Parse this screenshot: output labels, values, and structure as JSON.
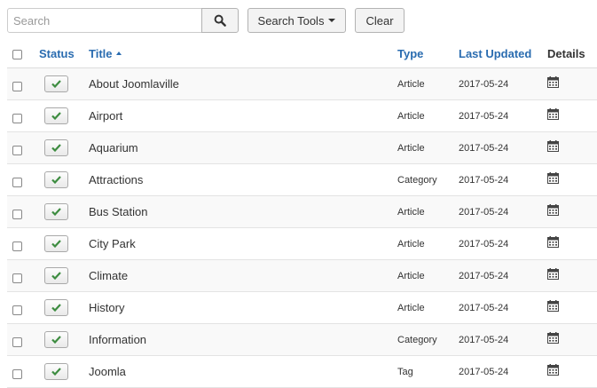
{
  "toolbar": {
    "search_placeholder": "Search",
    "search_tools_label": "Search Tools",
    "clear_label": "Clear"
  },
  "table": {
    "headers": {
      "status": "Status",
      "title": "Title",
      "type": "Type",
      "last_updated": "Last Updated",
      "details": "Details"
    },
    "sort": {
      "column": "Title",
      "direction": "ascending"
    },
    "rows": [
      {
        "status": "published",
        "title": "About Joomlaville",
        "type": "Article",
        "date": "2017-05-24"
      },
      {
        "status": "published",
        "title": "Airport",
        "type": "Article",
        "date": "2017-05-24"
      },
      {
        "status": "published",
        "title": "Aquarium",
        "type": "Article",
        "date": "2017-05-24"
      },
      {
        "status": "published",
        "title": "Attractions",
        "type": "Category",
        "date": "2017-05-24"
      },
      {
        "status": "published",
        "title": "Bus Station",
        "type": "Article",
        "date": "2017-05-24"
      },
      {
        "status": "published",
        "title": "City Park",
        "type": "Article",
        "date": "2017-05-24"
      },
      {
        "status": "published",
        "title": "Climate",
        "type": "Article",
        "date": "2017-05-24"
      },
      {
        "status": "published",
        "title": "History",
        "type": "Article",
        "date": "2017-05-24"
      },
      {
        "status": "published",
        "title": "Information",
        "type": "Category",
        "date": "2017-05-24"
      },
      {
        "status": "published",
        "title": "Joomla",
        "type": "Tag",
        "date": "2017-05-24"
      }
    ]
  },
  "colors": {
    "link": "#2a6cb0",
    "check": "#3d8c40",
    "row_alt": "#f9f9f9"
  },
  "icons": {
    "search_button": "search-icon",
    "search_tools": "caret-down-icon",
    "status": "checkmark-icon",
    "details": "calendar-icon",
    "sort": "caret-up-icon"
  }
}
